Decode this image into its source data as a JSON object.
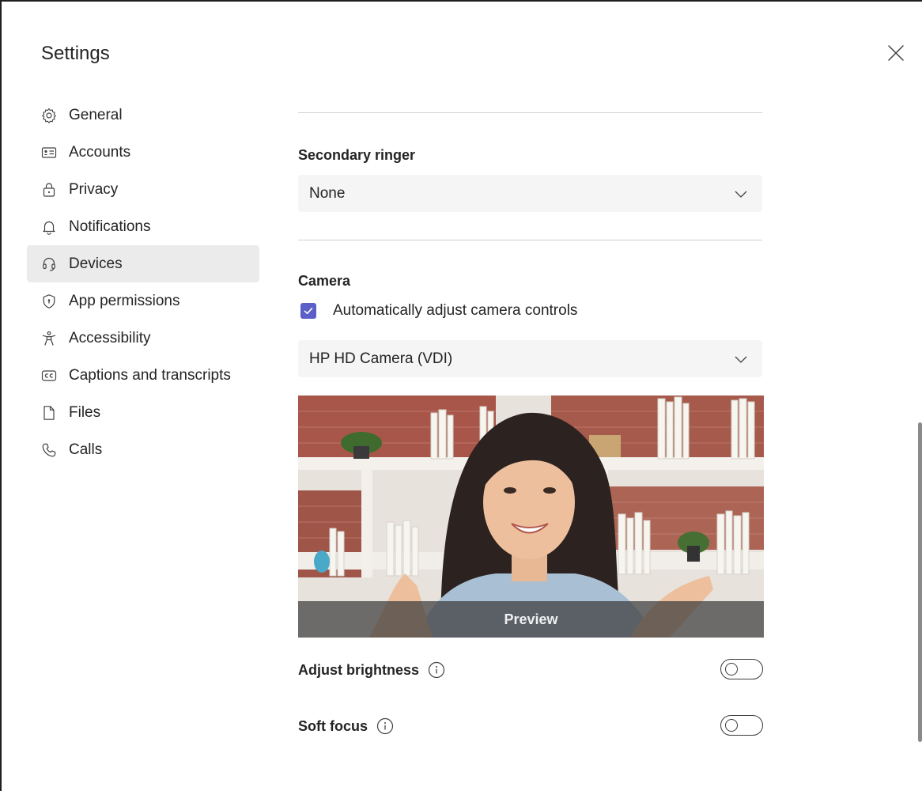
{
  "dialog": {
    "title": "Settings"
  },
  "nav": {
    "items": [
      {
        "label": "General",
        "icon": "gear-icon"
      },
      {
        "label": "Accounts",
        "icon": "id-card-icon"
      },
      {
        "label": "Privacy",
        "icon": "lock-icon"
      },
      {
        "label": "Notifications",
        "icon": "bell-icon"
      },
      {
        "label": "Devices",
        "icon": "headset-icon",
        "selected": true
      },
      {
        "label": "App permissions",
        "icon": "shield-icon"
      },
      {
        "label": "Accessibility",
        "icon": "accessibility-icon"
      },
      {
        "label": "Captions and transcripts",
        "icon": "closed-captions-icon"
      },
      {
        "label": "Files",
        "icon": "file-icon"
      },
      {
        "label": "Calls",
        "icon": "phone-icon"
      }
    ]
  },
  "secondary_ringer": {
    "heading": "Secondary ringer",
    "value": "None"
  },
  "camera": {
    "heading": "Camera",
    "auto_adjust_label": "Automatically adjust camera controls",
    "auto_adjust_checked": true,
    "device": "HP HD Camera (VDI)",
    "preview_label": "Preview"
  },
  "adjust_brightness": {
    "label": "Adjust brightness",
    "enabled": false
  },
  "soft_focus": {
    "label": "Soft focus",
    "enabled": false
  },
  "colors": {
    "accent": "#5b5fc7",
    "selected_nav": "#ebebeb",
    "input_bg": "#f5f5f5"
  }
}
